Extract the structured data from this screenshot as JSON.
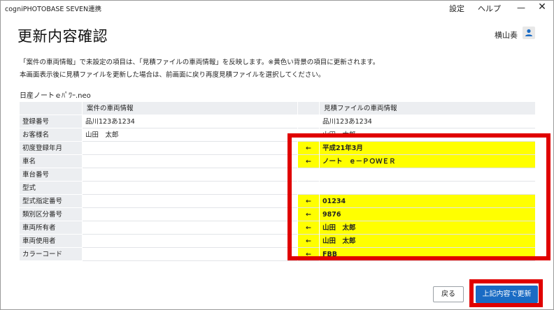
{
  "app": {
    "title": "cogniPHOTOBASE SEVEN連携",
    "menu": {
      "settings": "設定",
      "help": "ヘルプ"
    },
    "window_controls": {
      "minimize": "—",
      "close": "✕"
    }
  },
  "page": {
    "title": "更新内容確認",
    "user_name": "横山奏",
    "description_line1": "「案件の車両情報」で未設定の項目は、「見積ファイルの車両情報」を反映します。※黄色い背景の項目に更新されます。",
    "description_line2": "本画面表示後に見積ファイルを更新した場合は、前画面に戻り再度見積ファイルを選択してください。",
    "filename": "日産ノートｅﾊﾟﾜｰ.neo"
  },
  "table": {
    "headers": {
      "label": "",
      "case": "案件の車両情報",
      "arrow": "",
      "estimate": "見積ファイルの車両情報"
    },
    "rows": [
      {
        "label": "登録番号",
        "case": "品川123あ1234",
        "arrow": "",
        "estimate": "品川123あ1234",
        "highlight": false
      },
      {
        "label": "お客様名",
        "case": "山田　太郎",
        "arrow": "",
        "estimate": "山田　太郎",
        "highlight": false
      },
      {
        "label": "初度登録年月",
        "case": "",
        "arrow": "←",
        "estimate": "平成21年3月",
        "highlight": true
      },
      {
        "label": "車名",
        "case": "",
        "arrow": "←",
        "estimate": "ノート　ｅ－ＰＯＷＥＲ",
        "highlight": true
      },
      {
        "label": "車台番号",
        "case": "",
        "arrow": "",
        "estimate": "",
        "highlight": false
      },
      {
        "label": "型式",
        "case": "",
        "arrow": "",
        "estimate": "",
        "highlight": false
      },
      {
        "label": "型式指定番号",
        "case": "",
        "arrow": "←",
        "estimate": "01234",
        "highlight": true
      },
      {
        "label": "類別区分番号",
        "case": "",
        "arrow": "←",
        "estimate": "9876",
        "highlight": true
      },
      {
        "label": "車両所有者",
        "case": "",
        "arrow": "←",
        "estimate": "山田　太郎",
        "highlight": true
      },
      {
        "label": "車両使用者",
        "case": "",
        "arrow": "←",
        "estimate": "山田　太郎",
        "highlight": true
      },
      {
        "label": "カラーコード",
        "case": "",
        "arrow": "←",
        "estimate": "FBB",
        "highlight": true
      }
    ]
  },
  "buttons": {
    "back": "戻る",
    "update": "上記内容で更新"
  },
  "colors": {
    "highlight": "#ffff00",
    "accent": "#1a6bc4",
    "annotation": "#e00000"
  }
}
